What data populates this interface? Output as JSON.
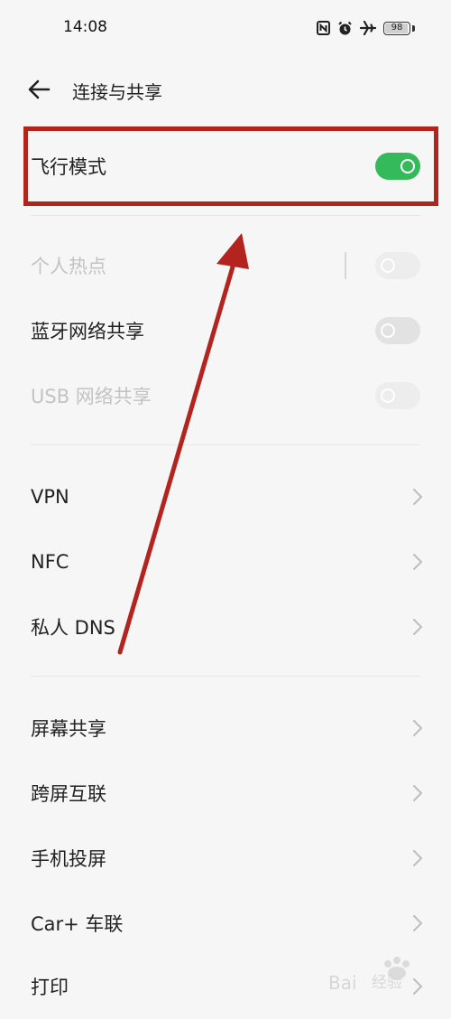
{
  "status": {
    "time": "14:08",
    "battery": "98",
    "battery_level": 0.98
  },
  "header": {
    "title": "连接与共享"
  },
  "items": [
    {
      "label": "飞行模式"
    },
    {
      "label": "个人热点"
    },
    {
      "label": "蓝牙网络共享"
    },
    {
      "label": "USB 网络共享"
    },
    {
      "label": "VPN"
    },
    {
      "label": "NFC"
    },
    {
      "label": "私人 DNS"
    },
    {
      "label": "屏幕共享"
    },
    {
      "label": "跨屏互联"
    },
    {
      "label": "手机投屏"
    },
    {
      "label": "Car+ 车联"
    },
    {
      "label": "打印"
    }
  ],
  "toggles": {
    "airplane_mode": true,
    "hotspot": false,
    "bluetooth_tethering": false,
    "usb_tethering": false
  },
  "colors": {
    "toggle_on": "#34b95b",
    "annotation": "#b3241e",
    "background": "#f6f6f6"
  },
  "icons": [
    "nfc-icon",
    "alarm-icon",
    "airplane-icon",
    "battery-icon",
    "back-arrow-icon",
    "chevron-right-icon"
  ]
}
